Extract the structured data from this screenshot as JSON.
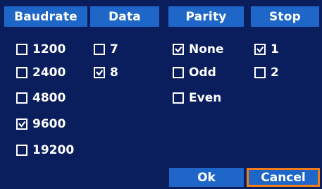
{
  "headers": {
    "baudrate": "Baudrate",
    "data": "Data",
    "parity": "Parity",
    "stop": "Stop"
  },
  "baudrate": [
    {
      "label": "1200",
      "checked": false
    },
    {
      "label": "2400",
      "checked": false
    },
    {
      "label": "4800",
      "checked": false
    },
    {
      "label": "9600",
      "checked": true
    },
    {
      "label": "19200",
      "checked": false
    }
  ],
  "data_bits": [
    {
      "label": "7",
      "checked": false
    },
    {
      "label": "8",
      "checked": true
    }
  ],
  "parity": [
    {
      "label": "None",
      "checked": true
    },
    {
      "label": "Odd",
      "checked": false
    },
    {
      "label": "Even",
      "checked": false
    }
  ],
  "stop_bits": [
    {
      "label": "1",
      "checked": true
    },
    {
      "label": "2",
      "checked": false
    }
  ],
  "buttons": {
    "ok": "Ok",
    "cancel": "Cancel",
    "focused": "cancel"
  },
  "colors": {
    "background": "#0a1e5e",
    "header": "#1e67c8",
    "focus_border": "#f07d1a",
    "text": "#ffffff"
  },
  "icons": {
    "checkbox_checked": "checkmark-icon"
  }
}
